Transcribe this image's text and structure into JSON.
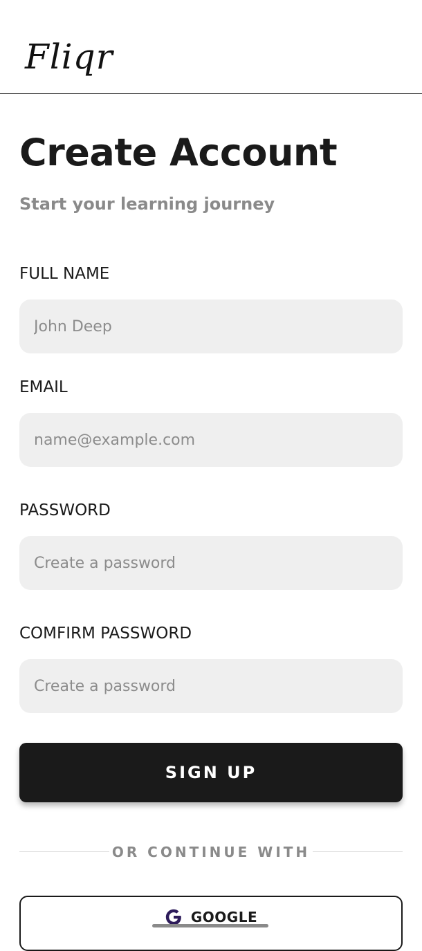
{
  "header": {
    "logo_text": "Fliqr"
  },
  "page": {
    "title": "Create Account",
    "subtitle": "Start your learning journey"
  },
  "form": {
    "full_name": {
      "label": "FULL NAME",
      "placeholder": "John Deep",
      "value": ""
    },
    "email": {
      "label": "EMAIL",
      "placeholder": "name@example.com",
      "value": ""
    },
    "password": {
      "label": "PASSWORD",
      "placeholder": "Create a password",
      "value": ""
    },
    "confirm_password": {
      "label": "COMFIRM PASSWORD",
      "placeholder": "Create a password",
      "value": ""
    },
    "signup_label": "SIGN UP"
  },
  "alternate": {
    "divider_text": "OR CONTINUE WITH",
    "google_label": "GOOGLE",
    "google_icon": "google-g-icon"
  },
  "colors": {
    "primary": "#1a1a1a",
    "input_bg": "#efefef",
    "muted_text": "#8a8a8a",
    "google_icon": "#2d1b5a"
  }
}
